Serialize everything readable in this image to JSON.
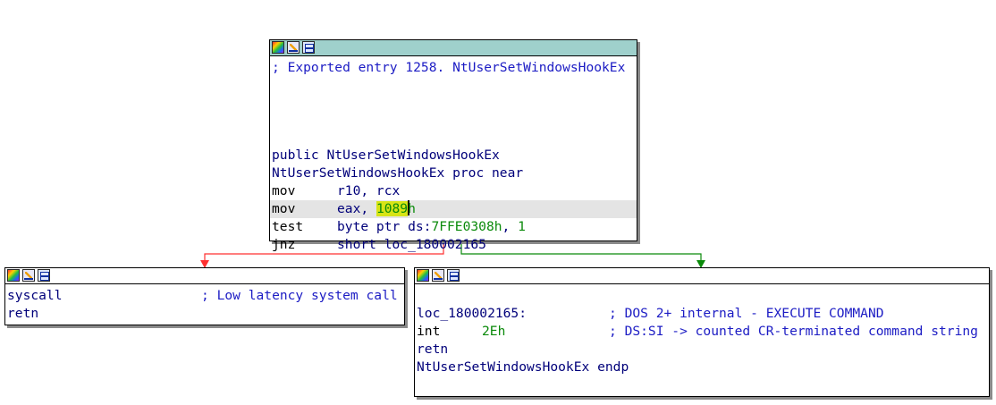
{
  "top_block": {
    "comment": "; Exported entry 1258. NtUserSetWindowsHookEx",
    "public_line": "public NtUserSetWindowsHookEx",
    "proc_line": "NtUserSetWindowsHookEx proc near",
    "instructions": [
      {
        "mnemonic": "mov",
        "operands": "r10, rcx"
      },
      {
        "mnemonic": "mov",
        "operand_prefix": "eax, ",
        "operand_highlight": "1089",
        "operand_suffix": "h"
      },
      {
        "mnemonic": "test",
        "operand_prefix": "byte ptr ds:",
        "operand_addr": "7FFE0308h",
        "operand_sep": ", ",
        "operand_imm": "1"
      },
      {
        "mnemonic": "jnz",
        "operands": "short loc_180002165"
      }
    ]
  },
  "left_block": {
    "instructions": [
      {
        "mnemonic": "syscall",
        "comment": "; Low latency system call"
      },
      {
        "mnemonic": "retn"
      }
    ]
  },
  "right_block": {
    "label": "loc_180002165:",
    "label_comment": "; DOS 2+ internal - EXECUTE COMMAND",
    "int_mnemonic": "int",
    "int_operand": "2Eh",
    "int_comment": "; DS:SI -> counted CR-terminated command string",
    "retn": "retn",
    "endp_line": "NtUserSetWindowsHookEx endp"
  },
  "header_icons": [
    "color-palette-icon",
    "rename-node-icon",
    "graph-overview-icon"
  ],
  "edges": {
    "false_branch_color": "#ff3030",
    "true_branch_color": "#0a8a0a"
  }
}
